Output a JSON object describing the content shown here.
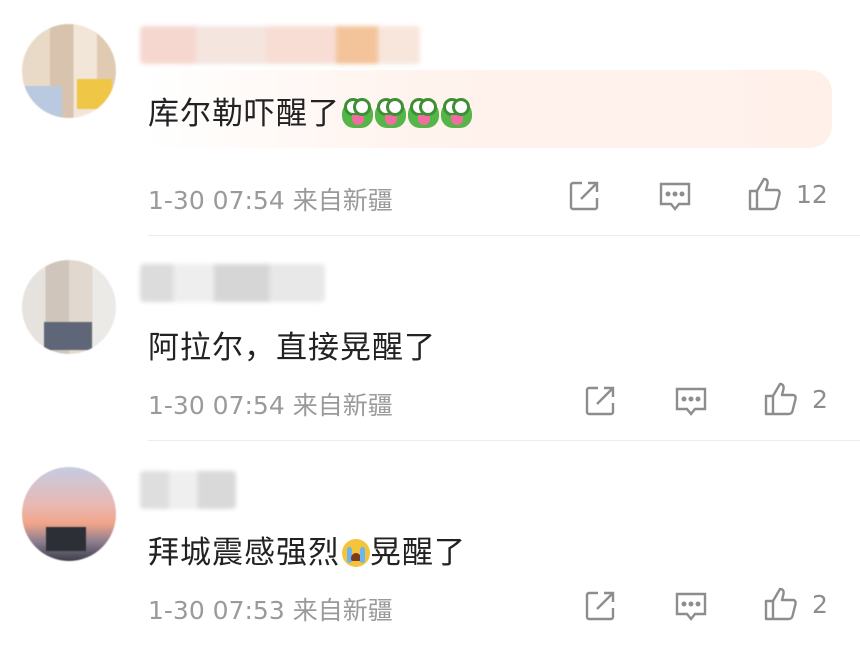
{
  "comments": [
    {
      "text": "库尔勒吓醒了",
      "emoji": [
        "frog-emoji",
        "frog-emoji",
        "frog-emoji",
        "frog-emoji"
      ],
      "time": "1-30 07:54",
      "location": "来自新疆",
      "likes": "12"
    },
    {
      "text": "阿拉尔，直接晃醒了",
      "time": "1-30 07:54",
      "location": "来自新疆",
      "likes": "2"
    },
    {
      "text_before": "拜城震感强烈",
      "emoji": [
        "crying-emoji"
      ],
      "text_after": "晃醒了",
      "time": "1-30 07:53",
      "location": "来自新疆",
      "likes": "2"
    }
  ],
  "icons": {
    "share": "share-icon",
    "reply": "comment-icon",
    "like": "thumbs-up-icon"
  },
  "colors": {
    "text": "#222222",
    "meta": "#9a9a9a",
    "icon": "#8d8d8d",
    "highlight": "#fff0ea"
  }
}
